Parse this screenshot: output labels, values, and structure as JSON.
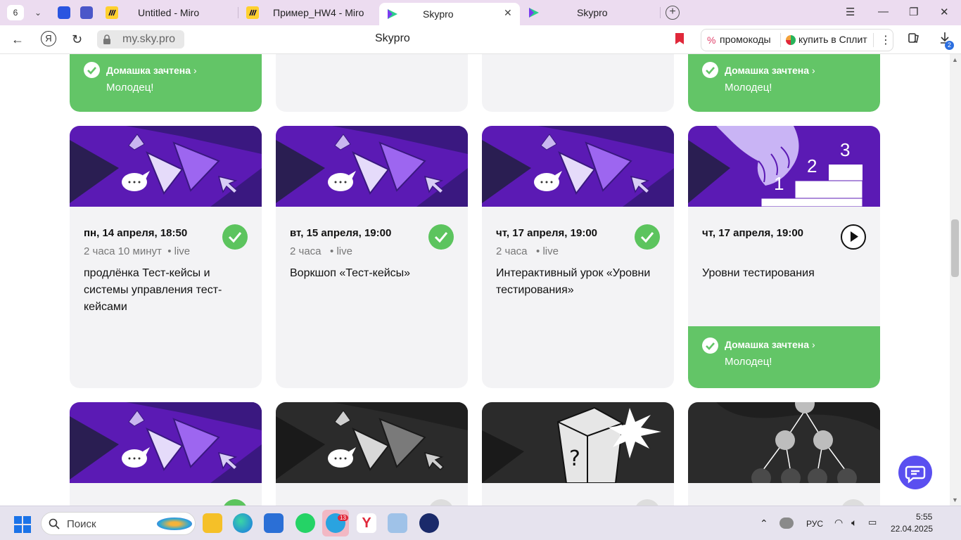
{
  "browser": {
    "tab_count": "6",
    "tabs": [
      {
        "label": "Untitled - Miro"
      },
      {
        "label": "Пример_HW4 - Miro"
      },
      {
        "label": "Skypro"
      },
      {
        "label": "Skypro"
      }
    ],
    "url": "my.sky.pro",
    "page_title": "Skypro",
    "promo_label": "промокоды",
    "split_label": "купить в Сплит",
    "downloads_badge": "2"
  },
  "homework": {
    "title": "Домашка зачтена",
    "subtitle": "Молодец!"
  },
  "lessons": [
    {
      "date": "пн, 14 апреля, 18:50",
      "duration": "2 часа 10 минут",
      "format": "live",
      "title": "продлёнка Тест-кейсы и системы управления тест-кейсами",
      "status": "done"
    },
    {
      "date": "вт, 15 апреля, 19:00",
      "duration": "2 часа",
      "format": "live",
      "title": "Воркшоп «Тест-кейсы»",
      "status": "done"
    },
    {
      "date": "чт, 17 апреля, 19:00",
      "duration": "2 часа",
      "format": "live",
      "title": "Интерактивный урок «Уровни тестирования»",
      "status": "done"
    },
    {
      "date": "чт, 17 апреля, 19:00",
      "duration": "",
      "format": "",
      "title": "Уровни тестирования",
      "status": "play"
    }
  ],
  "stair_numbers": [
    "1",
    "2",
    "3"
  ],
  "colors": {
    "brand_purple": "#5b1ab4",
    "success_green": "#63c567",
    "card_bg": "#f3f3f5",
    "chat_button": "#5a4ff0"
  },
  "taskbar": {
    "search_label": "Поиск",
    "telegram_badge": "13",
    "language": "РУС",
    "time": "5:55",
    "date": "22.04.2025"
  }
}
